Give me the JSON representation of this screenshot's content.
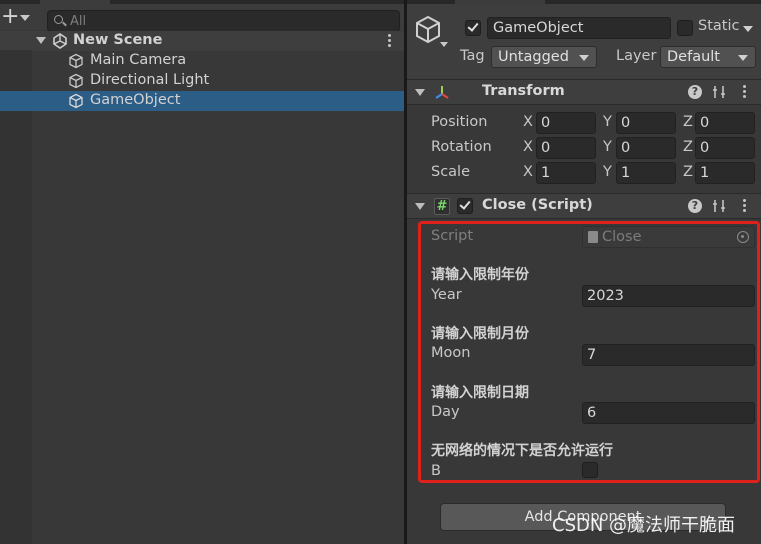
{
  "hierarchy": {
    "search_placeholder": "All",
    "scene": {
      "name": "New Scene",
      "icon": "unity-scene-icon"
    },
    "items": [
      {
        "label": "Main Camera",
        "icon": "gameobject-cube-icon",
        "selected": false
      },
      {
        "label": "Directional Light",
        "icon": "gameobject-cube-icon",
        "selected": false
      },
      {
        "label": "GameObject",
        "icon": "gameobject-cube-icon",
        "selected": true
      }
    ]
  },
  "inspector": {
    "object": {
      "active": true,
      "name": "GameObject",
      "static_label": "Static",
      "static_checked": false,
      "tag_label": "Tag",
      "tag_value": "Untagged",
      "layer_label": "Layer",
      "layer_value": "Default"
    },
    "transform": {
      "title": "Transform",
      "position": {
        "label": "Position",
        "x": "0",
        "y": "0",
        "z": "0"
      },
      "rotation": {
        "label": "Rotation",
        "x": "0",
        "y": "0",
        "z": "0"
      },
      "scale": {
        "label": "Scale",
        "x": "1",
        "y": "1",
        "z": "1"
      },
      "axis_x": "X",
      "axis_y": "Y",
      "axis_z": "Z"
    },
    "script_component": {
      "title": "Close (Script)",
      "enabled": true,
      "script_label": "Script",
      "script_value": "Close",
      "fields": [
        {
          "header": "请输入限制年份",
          "label": "Year",
          "value": "2023"
        },
        {
          "header": "请输入限制月份",
          "label": "Moon",
          "value": "7"
        },
        {
          "header": "请输入限制日期",
          "label": "Day",
          "value": "6"
        }
      ],
      "bool_field": {
        "header": "无网络的情况下是否允许运行",
        "label": "B",
        "checked": false
      }
    },
    "add_component_label": "Add Component",
    "highlight_color": "#e0201b"
  },
  "watermark": "CSDN @魔法师干脆面",
  "colors": {
    "selection": "#2c5d87",
    "background": "#383838",
    "field": "#2a2a2a"
  }
}
